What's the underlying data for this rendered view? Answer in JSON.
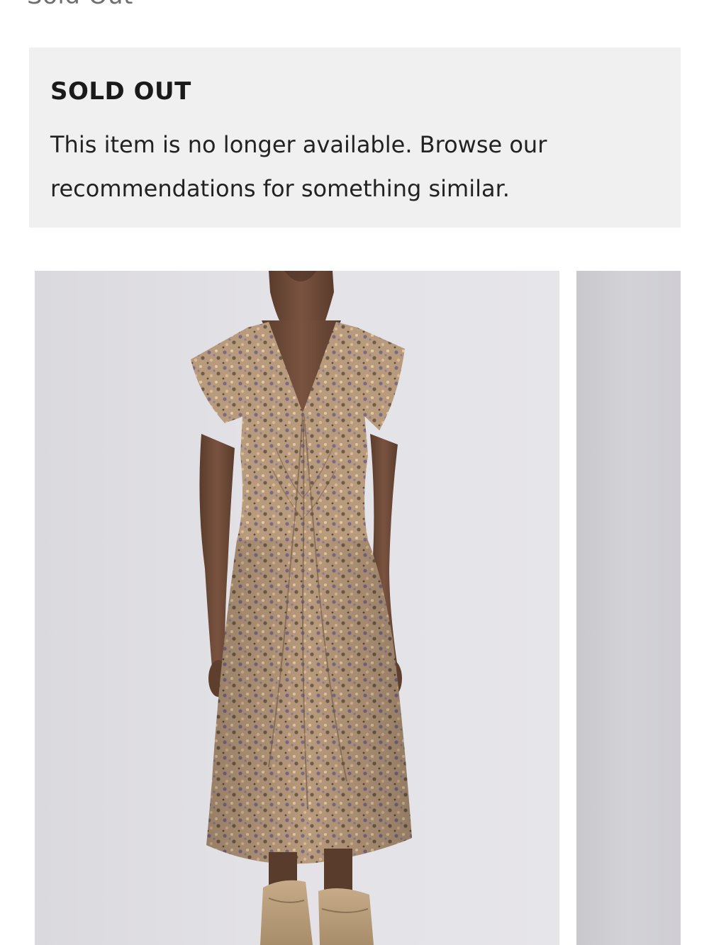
{
  "header": {
    "status_text": "Sold Out"
  },
  "notice": {
    "title": "SOLD OUT",
    "message": "This item is no longer available. Browse our recommendations for something similar."
  },
  "carousel": {
    "images": [
      {
        "alt": "Floral print ruched midi dress worn by model"
      },
      {
        "alt": "Next product image"
      }
    ]
  },
  "colors": {
    "notice_background": "#f0f0f1",
    "text_primary": "#1a1a1a",
    "text_muted": "#6e6e6e",
    "photo_background": "#e3e2e6"
  }
}
